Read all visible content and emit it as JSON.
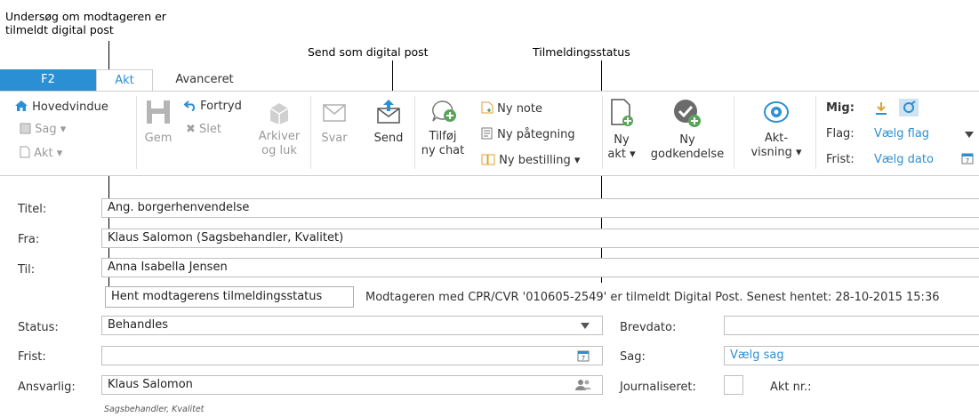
{
  "callouts": {
    "check_line1": "Undersøg om modtageren er",
    "check_line2": "tilmeldt digital post",
    "send_digital": "Send som digital post",
    "status": "Tilmeldingsstatus"
  },
  "tabs": [
    "F2",
    "Akt",
    "Avanceret"
  ],
  "ribbon": {
    "hovedvindue": "Hovedvindue",
    "sag": "Sag",
    "akt": "Akt",
    "gem": "Gem",
    "fortryd": "Fortryd",
    "slet": "Slet",
    "arkiver_1": "Arkiver",
    "arkiver_2": "og luk",
    "svar": "Svar",
    "send": "Send",
    "tilfoej_1": "Tilføj",
    "tilfoej_2": "ny chat",
    "ny_note": "Ny note",
    "ny_paategning": "Ny påtegning",
    "ny_bestilling": "Ny bestilling",
    "ny_akt_1": "Ny",
    "ny_akt_2": "akt",
    "ny_godk_1": "Ny",
    "ny_godk_2": "godkendelse",
    "akt_visning_1": "Akt-",
    "akt_visning_2": "visning",
    "mig": "Mig:",
    "flag_label": "Flag:",
    "flag_value": "Vælg flag",
    "frist_label": "Frist:",
    "frist_value": "Vælg dato"
  },
  "form": {
    "titel_label": "Titel:",
    "titel_value": "Ang. borgerhenvendelse",
    "fra_label": "Fra:",
    "fra_value": "Klaus Salomon (Sagsbehandler, Kvalitet)",
    "til_label": "Til:",
    "til_value": "Anna Isabella Jensen",
    "hent_button": "Hent modtagerens tilmeldingsstatus",
    "status_message": "Modtageren med CPR/CVR '010605-2549' er tilmeldt Digital Post. Senest hentet: 28-10-2015 15:36",
    "status_label": "Status:",
    "status_value": "Behandles",
    "frist_label": "Frist:",
    "frist_value": "",
    "ansvarlig_label": "Ansvarlig:",
    "ansvarlig_value": "Klaus Salomon",
    "ansvarlig_sub": "Sagsbehandler, Kvalitet",
    "brevdato_label": "Brevdato:",
    "sag_label": "Sag:",
    "sag_value": "Vælg sag",
    "journaliseret_label": "Journaliseret:",
    "aktnr_label": "Akt nr.:"
  },
  "colors": {
    "accent": "#2b8fd3",
    "disabled": "#9a9a9a"
  }
}
